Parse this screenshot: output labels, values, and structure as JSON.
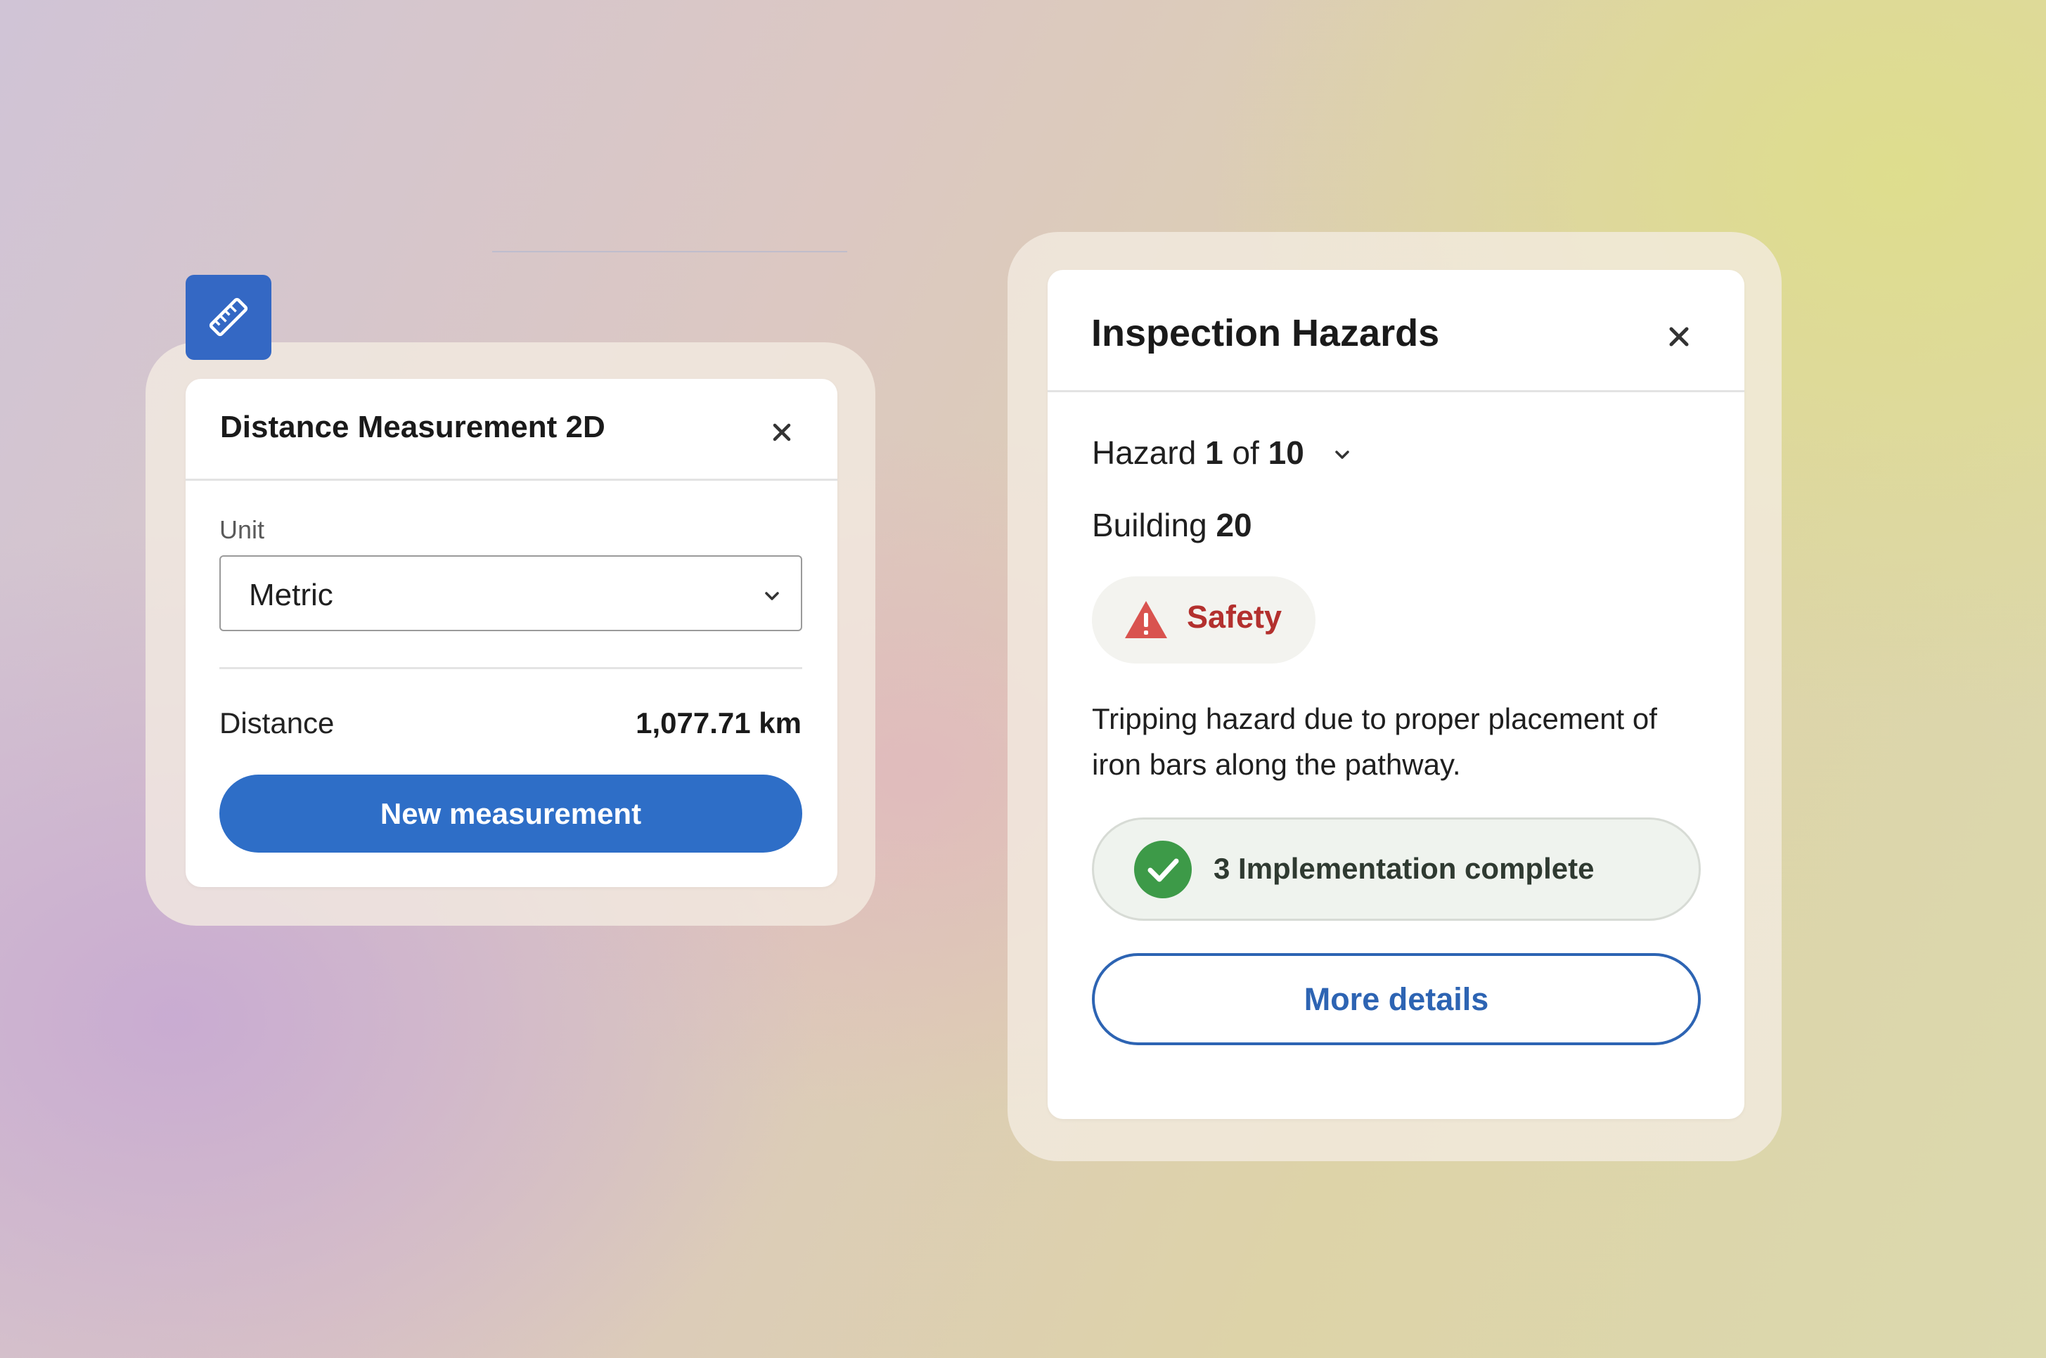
{
  "measurement_panel": {
    "tool_icon": "ruler-icon",
    "title": "Distance Measurement 2D",
    "close_icon": "close-icon",
    "unit_label": "Unit",
    "unit_value": "Metric",
    "unit_dropdown_icon": "chevron-down-icon",
    "distance_label": "Distance",
    "distance_value": "1,077.71 km",
    "new_measurement_label": "New measurement"
  },
  "hazards_panel": {
    "title": "Inspection Hazards",
    "close_icon": "close-icon",
    "hazard_prefix": "Hazard",
    "hazard_current": "1",
    "hazard_of": "of",
    "hazard_total": "10",
    "hazard_dropdown_icon": "chevron-down-icon",
    "building_prefix": "Building",
    "building_number": "20",
    "category_icon": "warning-triangle-icon",
    "category_label": "Safety",
    "description_line1": "Tripping hazard due to proper placement of",
    "description_line2": "iron bars along the pathway.",
    "status_icon": "check-circle-icon",
    "status_label": "3 Implementation complete",
    "more_details_label": "More details"
  },
  "colors": {
    "primary_blue": "#2e6ec7",
    "outline_blue": "#2d64b3",
    "safety_red": "#b3302e",
    "warning_icon_red": "#d9534f",
    "success_green": "#3d9a48"
  }
}
